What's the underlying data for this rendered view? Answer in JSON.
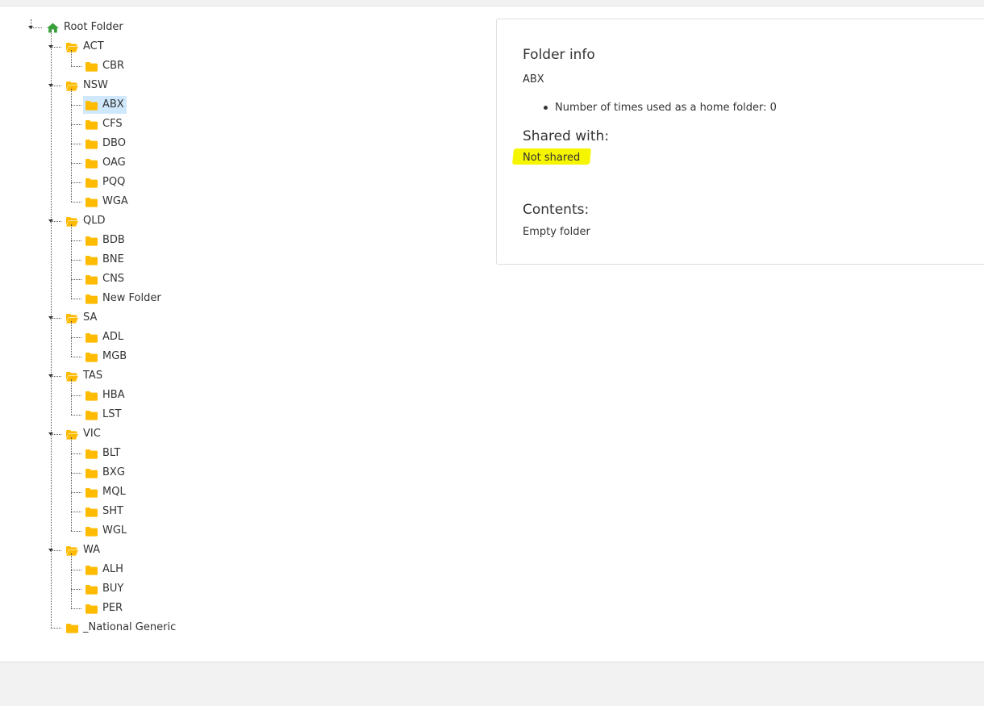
{
  "tree": {
    "root": "Root Folder",
    "groups": [
      {
        "name": "ACT",
        "children": [
          "CBR"
        ]
      },
      {
        "name": "NSW",
        "children": [
          "ABX",
          "CFS",
          "DBO",
          "OAG",
          "PQQ",
          "WGA"
        ]
      },
      {
        "name": "QLD",
        "children": [
          "BDB",
          "BNE",
          "CNS",
          "New Folder"
        ]
      },
      {
        "name": "SA",
        "children": [
          "ADL",
          "MGB"
        ]
      },
      {
        "name": "TAS",
        "children": [
          "HBA",
          "LST"
        ]
      },
      {
        "name": "VIC",
        "children": [
          "BLT",
          "BXG",
          "MQL",
          "SHT",
          "WGL"
        ]
      },
      {
        "name": "WA",
        "children": [
          "ALH",
          "BUY",
          "PER"
        ]
      }
    ],
    "extra_leaf": "_National Generic",
    "selected": "ABX"
  },
  "info": {
    "folder_info_heading": "Folder info",
    "folder_name": "ABX",
    "usage_text": "Number of times used as a home folder: 0",
    "shared_heading": "Shared with:",
    "shared_value": "Not shared",
    "contents_heading": "Contents:",
    "contents_value": "Empty folder"
  },
  "colors": {
    "folder": "#ffbb00",
    "home": "#3aa13a",
    "selected_bg": "#cfe8fb",
    "highlight": "#f5f500"
  },
  "icons": {
    "root": "home-icon",
    "group": "folder-open-icon",
    "leaf": "folder-icon"
  }
}
